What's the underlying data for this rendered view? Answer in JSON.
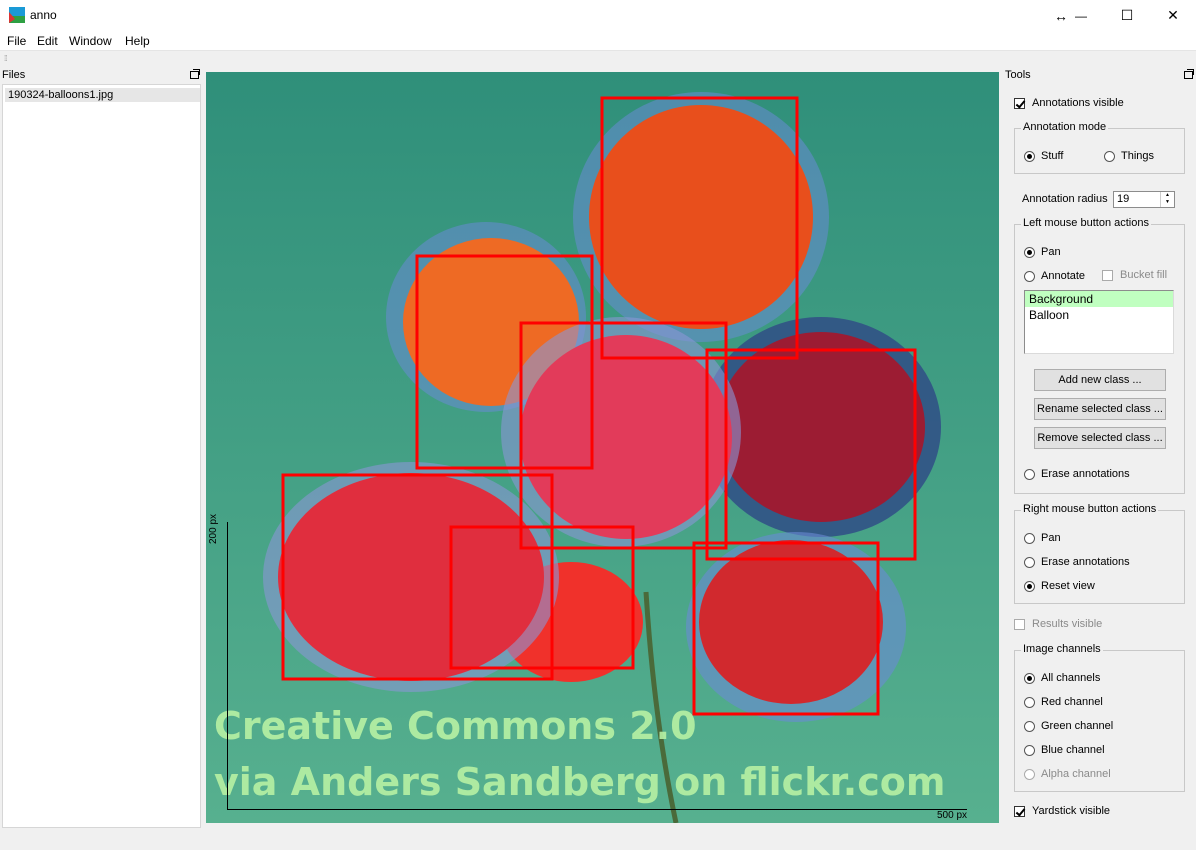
{
  "window": {
    "title": "anno",
    "controls": {
      "resize": "↔",
      "minimize": "—",
      "maximize": "☐",
      "close": "✕"
    }
  },
  "menu": [
    "File",
    "Edit",
    "Window",
    "Help"
  ],
  "files_panel": {
    "title": "Files",
    "files": [
      "190324-balloons1.jpg"
    ]
  },
  "image": {
    "watermark_line1": "Creative Commons 2.0",
    "watermark_line2": "via Anders Sandberg on flickr.com",
    "yardstick_vertical_label": "200 px",
    "yardstick_horizontal_label": "500 px",
    "annotation_box_color": "#ff0000",
    "background_color": "#3f9b83"
  },
  "tools": {
    "title": "Tools",
    "annotations_visible": {
      "label": "Annotations visible",
      "checked": true
    },
    "annotation_mode": {
      "title": "Annotation mode",
      "options": [
        {
          "label": "Stuff",
          "selected": true
        },
        {
          "label": "Things",
          "selected": false
        }
      ]
    },
    "annotation_radius": {
      "label": "Annotation radius",
      "value": "19"
    },
    "left_mouse": {
      "title": "Left mouse button actions",
      "pan": {
        "label": "Pan",
        "selected": true
      },
      "annotate": {
        "label": "Annotate",
        "selected": false
      },
      "bucket_fill": {
        "label": "Bucket fill",
        "checked": false,
        "enabled": false
      },
      "classes": [
        {
          "label": "Background",
          "color": "#c0ffc0",
          "selected": true
        },
        {
          "label": "Balloon",
          "color": "#ffffff",
          "selected": false
        }
      ],
      "add_class": "Add new class ...",
      "rename_class": "Rename selected class ...",
      "remove_class": "Remove selected class ...",
      "erase": {
        "label": "Erase annotations",
        "selected": false
      }
    },
    "right_mouse": {
      "title": "Right mouse button actions",
      "options": [
        {
          "label": "Pan",
          "selected": false
        },
        {
          "label": "Erase annotations",
          "selected": false
        },
        {
          "label": "Reset view",
          "selected": true
        }
      ]
    },
    "results_visible": {
      "label": "Results visible",
      "checked": false,
      "enabled": false
    },
    "image_channels": {
      "title": "Image channels",
      "options": [
        {
          "label": "All channels",
          "selected": true
        },
        {
          "label": "Red channel",
          "selected": false
        },
        {
          "label": "Green channel",
          "selected": false
        },
        {
          "label": "Blue channel",
          "selected": false
        },
        {
          "label": "Alpha channel",
          "selected": false,
          "enabled": false
        }
      ]
    },
    "yardstick_visible": {
      "label": "Yardstick visible",
      "checked": true
    }
  }
}
